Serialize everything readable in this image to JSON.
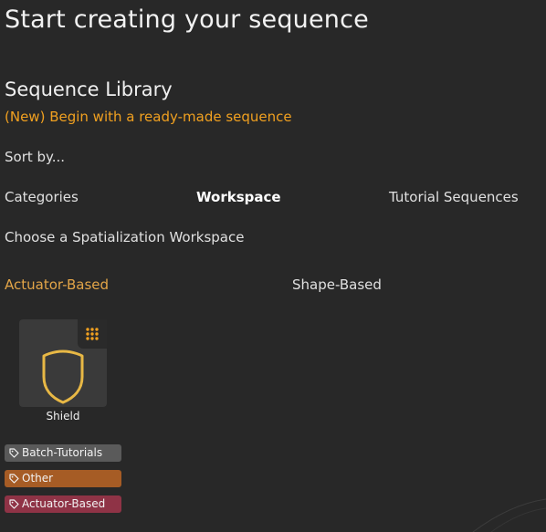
{
  "header": {
    "title": "Start creating your sequence"
  },
  "library": {
    "title": "Sequence Library",
    "subtitle": "(New) Begin with a ready-made sequence"
  },
  "sort": {
    "label": "Sort by...",
    "options": [
      "Categories",
      "Workspace",
      "Tutorial Sequences"
    ],
    "selected": "Workspace"
  },
  "workspace": {
    "prompt": "Choose a Spatialization Workspace",
    "options": [
      "Actuator-Based",
      "Shape-Based"
    ],
    "selected": "Actuator-Based"
  },
  "cards": [
    {
      "label": "Shield",
      "icon": "shield-icon",
      "badge_icon": "grid-dots-icon"
    }
  ],
  "tags": [
    {
      "label": "Batch-Tutorials",
      "color": "#5a5a5a",
      "icon": "tag-icon"
    },
    {
      "label": "Other",
      "color": "#a65c25",
      "icon": "tag-icon"
    },
    {
      "label": "Actuator-Based",
      "color": "#8f3346",
      "icon": "tag-icon"
    }
  ],
  "colors": {
    "background": "#282828",
    "accent_orange": "#f0a020",
    "accent_gold": "#e3a548"
  }
}
